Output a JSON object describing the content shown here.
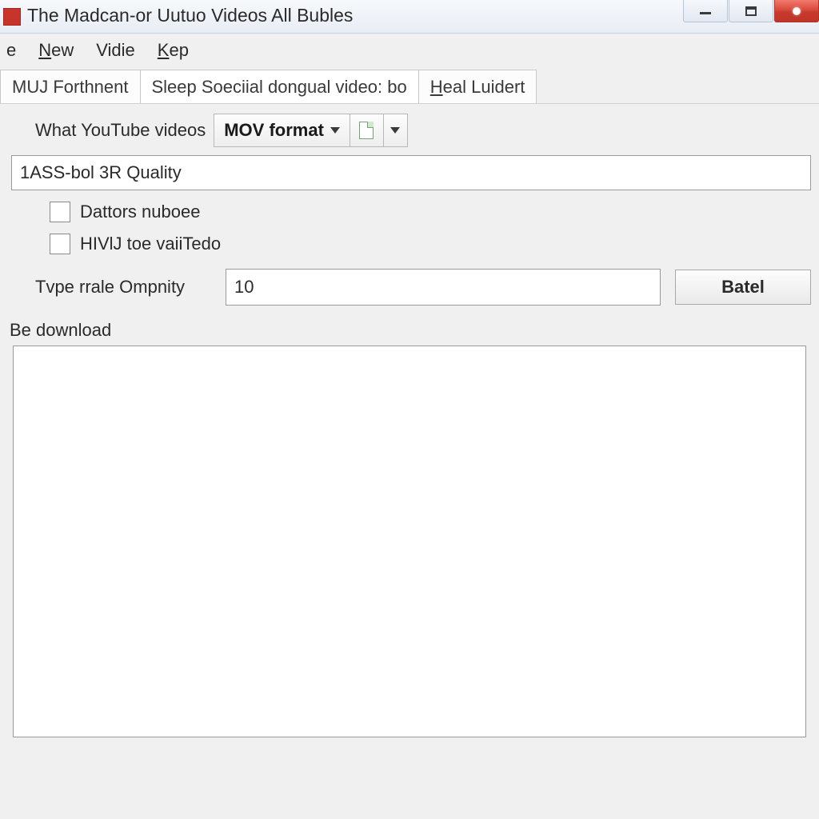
{
  "window": {
    "title": "The Madcan-or Uutuo Videos All Bubles"
  },
  "menu": {
    "item0_trunc": "e",
    "item1_pre": "",
    "item1_accel": "N",
    "item1_rest": "ew",
    "item2": "Vidie",
    "item3_accel": "K",
    "item3_rest": "ep"
  },
  "tabs": {
    "t0": "MUJ Forthnent",
    "t1": "Sleep Soeciial dongual video: bo",
    "t2_accel": "H",
    "t2_rest": "eal Luidert"
  },
  "toolbar": {
    "what_label": "What YouTube videos",
    "format_selected": "MOV format"
  },
  "quality_value": "1ASS-bol 3R Quality",
  "checks": {
    "c1": "Dattors nuboee",
    "c2": "HIVlJ toe vaiiTedo"
  },
  "numrow": {
    "label": "Tvpe rrale Ompnity",
    "value": "10",
    "button": "Batel"
  },
  "section": {
    "download_label": "Be download"
  }
}
